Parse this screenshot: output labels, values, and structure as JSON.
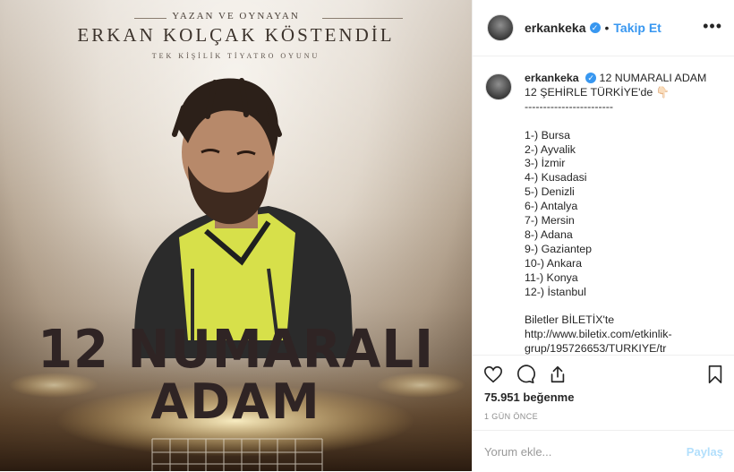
{
  "poster": {
    "line1": "YAZAN VE OYNAYAN",
    "line2": "ERKAN KOLÇAK KÖSTENDİL",
    "line3": "TEK KİŞİLİK TİYATRO OYUNU",
    "title1": "12 NUMARALI",
    "title2": "ADAM"
  },
  "header": {
    "username": "erkankeka",
    "verified_icon": "verified-badge-icon",
    "separator": "•",
    "follow_label": "Takip Et",
    "more_icon": "more-options-icon"
  },
  "caption": {
    "username": "erkankeka",
    "lines": [
      "12 NUMARALI ADAM",
      "12 ŞEHİRLE TÜRKİYE'de 👇🏻",
      "------------------------",
      "",
      "1-) Bursa",
      "2-) Ayvalik",
      "3-) İzmir",
      "4-) Kusadasi",
      "5-) Denizli",
      "6-) Antalya",
      "7-) Mersin",
      "8-) Adana",
      "9-) Gaziantep",
      "10-) Ankara",
      "11-) Konya",
      "12-) İstanbul",
      "",
      "Biletler BİLETİX'te",
      "http://www.biletix.com/etkinlik-",
      "grup/195726653/TURKIYE/tr"
    ]
  },
  "actions": {
    "like_icon": "heart-icon",
    "comment_icon": "comment-icon",
    "share_icon": "share-icon",
    "save_icon": "bookmark-icon"
  },
  "likes_text": "75.951 beğenme",
  "timestamp": "1 GÜN ÖNCE",
  "comment_box": {
    "placeholder": "Yorum ekle...",
    "submit_label": "Paylaş"
  },
  "colors": {
    "accent": "#3897f0",
    "submit_disabled": "#b2dffc",
    "border": "#efefef"
  }
}
